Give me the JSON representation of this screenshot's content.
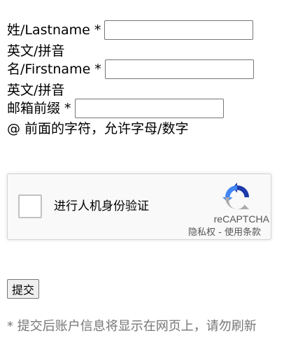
{
  "form": {
    "lastname": {
      "label": "姓/Lastname *",
      "value": "",
      "hint": "英文/拼音"
    },
    "firstname": {
      "label": "名/Firstname *",
      "value": "",
      "hint": "英文/拼音"
    },
    "email_prefix": {
      "label": "邮箱前缀 *",
      "value": "",
      "hint": "@ 前面的字符，允许字母/数字"
    },
    "submit_label": "提交",
    "footer_note": "* 提交后账户信息将显示在网页上，请勿刷新"
  },
  "recaptcha": {
    "checkbox_label": "进行人机身份验证",
    "brand": "reCAPTCHA",
    "privacy_link": "隐私权",
    "separator": " - ",
    "terms_link": "使用条款",
    "checked": false,
    "icon": "recaptcha-logo-icon"
  },
  "colors": {
    "recaptcha_blue": "#1c3aa9",
    "recaptcha_light_blue": "#4285f4",
    "recaptcha_gray": "#ababab",
    "note_gray": "#767676"
  }
}
